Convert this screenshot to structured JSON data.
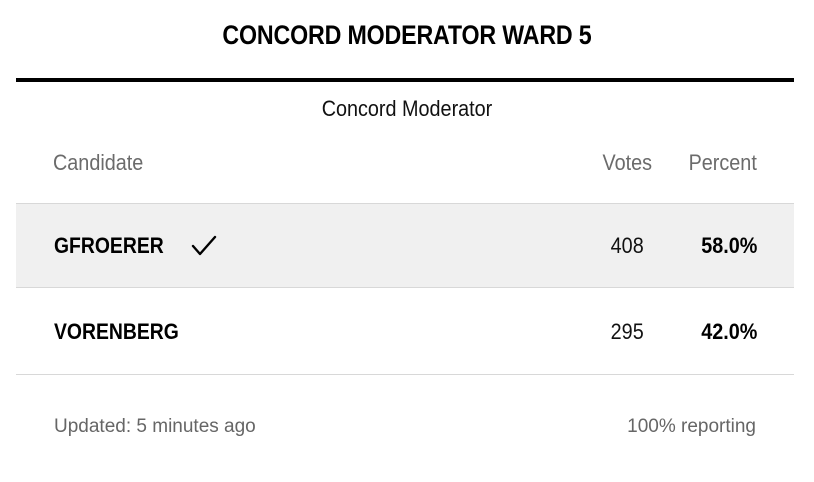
{
  "title": "CONCORD MODERATOR WARD 5",
  "race": {
    "name": "Concord Moderator"
  },
  "columns": {
    "candidate": "Candidate",
    "votes": "Votes",
    "percent": "Percent"
  },
  "candidates": [
    {
      "name": "GFROERER",
      "votes": "408",
      "percent": "58.0%",
      "winner": true,
      "winner_icon": "check-icon"
    },
    {
      "name": "VORENBERG",
      "votes": "295",
      "percent": "42.0%",
      "winner": false
    }
  ],
  "footer": {
    "updated": "Updated: 5 minutes ago",
    "reporting": "100% reporting"
  },
  "colors": {
    "winner_row_bg": "#f0f0f0",
    "rule": "#000000",
    "muted_text": "#666666"
  }
}
